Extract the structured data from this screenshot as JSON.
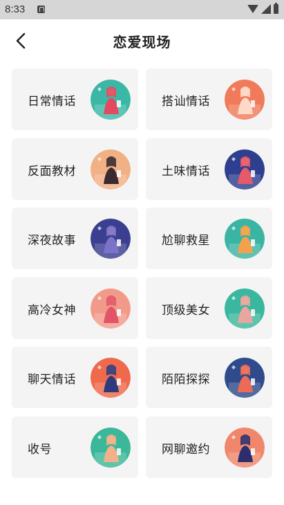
{
  "status_bar": {
    "time": "8:33",
    "icons": [
      "notification-a-icon",
      "wifi-icon",
      "signal-icon",
      "battery-icon"
    ]
  },
  "header": {
    "back_icon": "chevron-left-icon",
    "title": "恋爱现场"
  },
  "cards": [
    {
      "label": "日常情话",
      "illustration": "girl-phone-illustration",
      "bg": "#3bb7a6",
      "accent": "#e34a62"
    },
    {
      "label": "搭讪情话",
      "illustration": "flying-girl-illustration",
      "bg": "#f07a5a",
      "accent": "#ffd9c8"
    },
    {
      "label": "反面教材",
      "illustration": "longhair-girl-illustration",
      "bg": "#f2b184",
      "accent": "#3b2a2f"
    },
    {
      "label": "土味情话",
      "illustration": "couple-wine-illustration",
      "bg": "#2e3f8f",
      "accent": "#e6596a"
    },
    {
      "label": "深夜故事",
      "illustration": "night-girl-illustration",
      "bg": "#3a3f8f",
      "accent": "#7c72c9"
    },
    {
      "label": "尬聊救星",
      "illustration": "man-sitting-illustration",
      "bg": "#3ab4a3",
      "accent": "#f3a14d"
    },
    {
      "label": "高冷女神",
      "illustration": "cold-goddess-illustration",
      "bg": "#f29a8a",
      "accent": "#e25567"
    },
    {
      "label": "顶级美女",
      "illustration": "beauty-illustration",
      "bg": "#3ab79e",
      "accent": "#e9a5a0"
    },
    {
      "label": "聊天情话",
      "illustration": "chat-girl-illustration",
      "bg": "#ef6a4c",
      "accent": "#2d3a7c"
    },
    {
      "label": "陌陌探探",
      "illustration": "meetup-illustration",
      "bg": "#2f4b8c",
      "accent": "#eb6b58"
    },
    {
      "label": "收号",
      "illustration": "man-phone-illustration",
      "bg": "#3bb79a",
      "accent": "#f2b18a"
    },
    {
      "label": "网聊邀约",
      "illustration": "man-chat-illustration",
      "bg": "#f0876c",
      "accent": "#2c2f6e"
    }
  ]
}
